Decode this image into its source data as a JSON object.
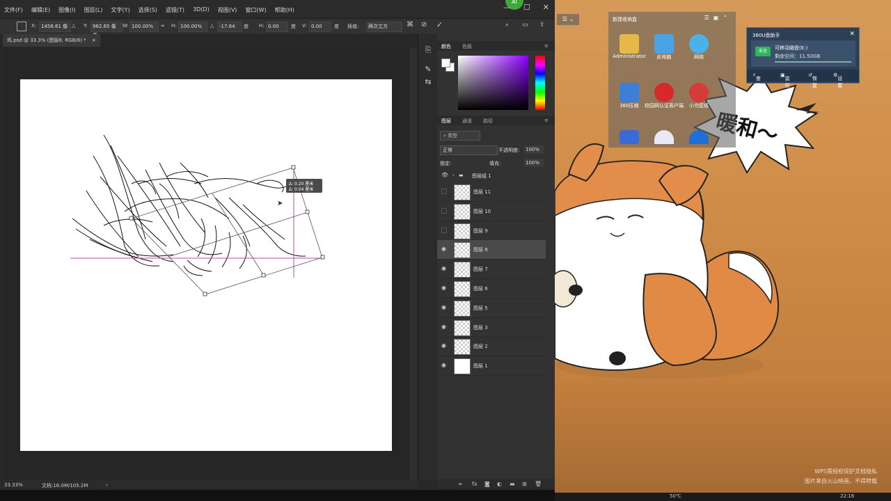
{
  "menu": {
    "items": [
      "文件(F)",
      "编辑(E)",
      "图像(I)",
      "图层(L)",
      "文字(Y)",
      "选择(S)",
      "滤镜(T)",
      "3D(D)",
      "视图(V)",
      "窗口(W)",
      "帮助(H)"
    ],
    "minimize": "—",
    "maximize": "☐",
    "close": "✕",
    "badge": "Al"
  },
  "options": {
    "x_label": "X:",
    "x_value": "1458.61 像",
    "y_label": "Y:",
    "y_value": "962.65 像素",
    "w_label": "W:",
    "w_value": "100.00%",
    "h_label": "H:",
    "h_value": "100.00%",
    "angle_value": "-17.64",
    "hskew_label": "H:",
    "hskew_value": "0.00",
    "vskew_label": "V:",
    "vskew_value": "0.00",
    "degree_unit": "度",
    "interp_label": "插值:",
    "interp_value": "两次立方"
  },
  "document": {
    "tab_title": "鸡.psd @ 33.3% (图层8, RGB/8) *",
    "tab_close": "×",
    "zoom": "33.33%",
    "docsize": "文档:16.0M/105.2M",
    "transform_tooltip": [
      "Δ: 0.20 厘米",
      "Δ: 0.04 厘米"
    ]
  },
  "panels": {
    "color_tab": "颜色",
    "swatches_tab": "色板",
    "layers_tab": "图层",
    "channels_tab": "通道",
    "paths_tab": "路径",
    "filter_kind": "类型",
    "blend_mode": "正常",
    "opacity_label": "不透明度:",
    "opacity_value": "100%",
    "lock_label": "锁定:",
    "fill_label": "填充:",
    "fill_value": "100%",
    "group_name": "图层组 1",
    "layers": [
      {
        "name": "图层 11",
        "visible": false,
        "selected": false
      },
      {
        "name": "图层 10",
        "visible": false,
        "selected": false
      },
      {
        "name": "图层 9",
        "visible": false,
        "selected": false
      },
      {
        "name": "图层 8",
        "visible": true,
        "selected": true
      },
      {
        "name": "图层 7",
        "visible": true,
        "selected": false
      },
      {
        "name": "图层 6",
        "visible": true,
        "selected": false
      },
      {
        "name": "图层 5",
        "visible": true,
        "selected": false
      },
      {
        "name": "图层 3",
        "visible": true,
        "selected": false
      },
      {
        "name": "图层 2",
        "visible": true,
        "selected": false
      },
      {
        "name": "图层 1",
        "visible": true,
        "selected": false
      }
    ]
  },
  "desktop": {
    "fence_title": "新建收纳盒",
    "icons": [
      {
        "label": "Administrator",
        "color": "#e6b84a"
      },
      {
        "label": "此电脑",
        "color": "#4aa3e6"
      },
      {
        "label": "网络",
        "color": "#4ab2e6"
      },
      {
        "label": "360压缩",
        "color": "#3b7fd6"
      },
      {
        "label": "校园网认证客户端",
        "color": "#d62a2a"
      },
      {
        "label": "小鸟壁纸",
        "color": "#d63b3b"
      }
    ],
    "row3_icon_colors": [
      "#3a6ad6",
      "#e8e8f6",
      "#1d6fd6"
    ],
    "speech_bubble": "暖和～",
    "assistant": {
      "title": "360U盘助手",
      "close": "✕",
      "safe": "安全",
      "disk_name": "可移动磁盘(E:)",
      "free_space": "剩余空间：11.50GB",
      "actions": [
        "查杀",
        "监控",
        "恢复",
        "设置"
      ]
    },
    "watermark_line1": "WPS需授权保护文档隐私",
    "watermark_line2": "图片来自火山映画，不得转载",
    "taskbar_temp": "50℃",
    "taskbar_time": "22:16"
  }
}
